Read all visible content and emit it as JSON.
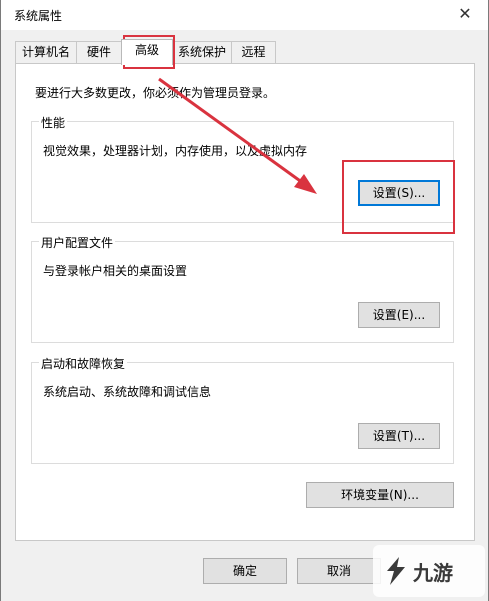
{
  "window": {
    "title": "系统属性",
    "close_glyph": "✕"
  },
  "tabs": [
    {
      "label": "计算机名"
    },
    {
      "label": "硬件"
    },
    {
      "label": "高级",
      "active": true
    },
    {
      "label": "系统保护"
    },
    {
      "label": "远程"
    }
  ],
  "admin_note": "要进行大多数更改，你必须作为管理员登录。",
  "performance": {
    "title": "性能",
    "desc": "视觉效果，处理器计划，内存使用，以及虚拟内存",
    "button": "设置(S)..."
  },
  "user_profiles": {
    "title": "用户配置文件",
    "desc": "与登录帐户相关的桌面设置",
    "button": "设置(E)..."
  },
  "startup_recovery": {
    "title": "启动和故障恢复",
    "desc": "系统启动、系统故障和调试信息",
    "button": "设置(T)..."
  },
  "env_button": "环境变量(N)...",
  "footer": {
    "ok": "确定",
    "cancel": "取消"
  },
  "watermark": {
    "text": "九游"
  },
  "colors": {
    "annotation": "#d9333f",
    "accent": "#0078d7"
  },
  "icons": {
    "close": "close-icon",
    "arrow": "red-arrow-annotation",
    "logo": "jiuyou-logo-icon"
  }
}
